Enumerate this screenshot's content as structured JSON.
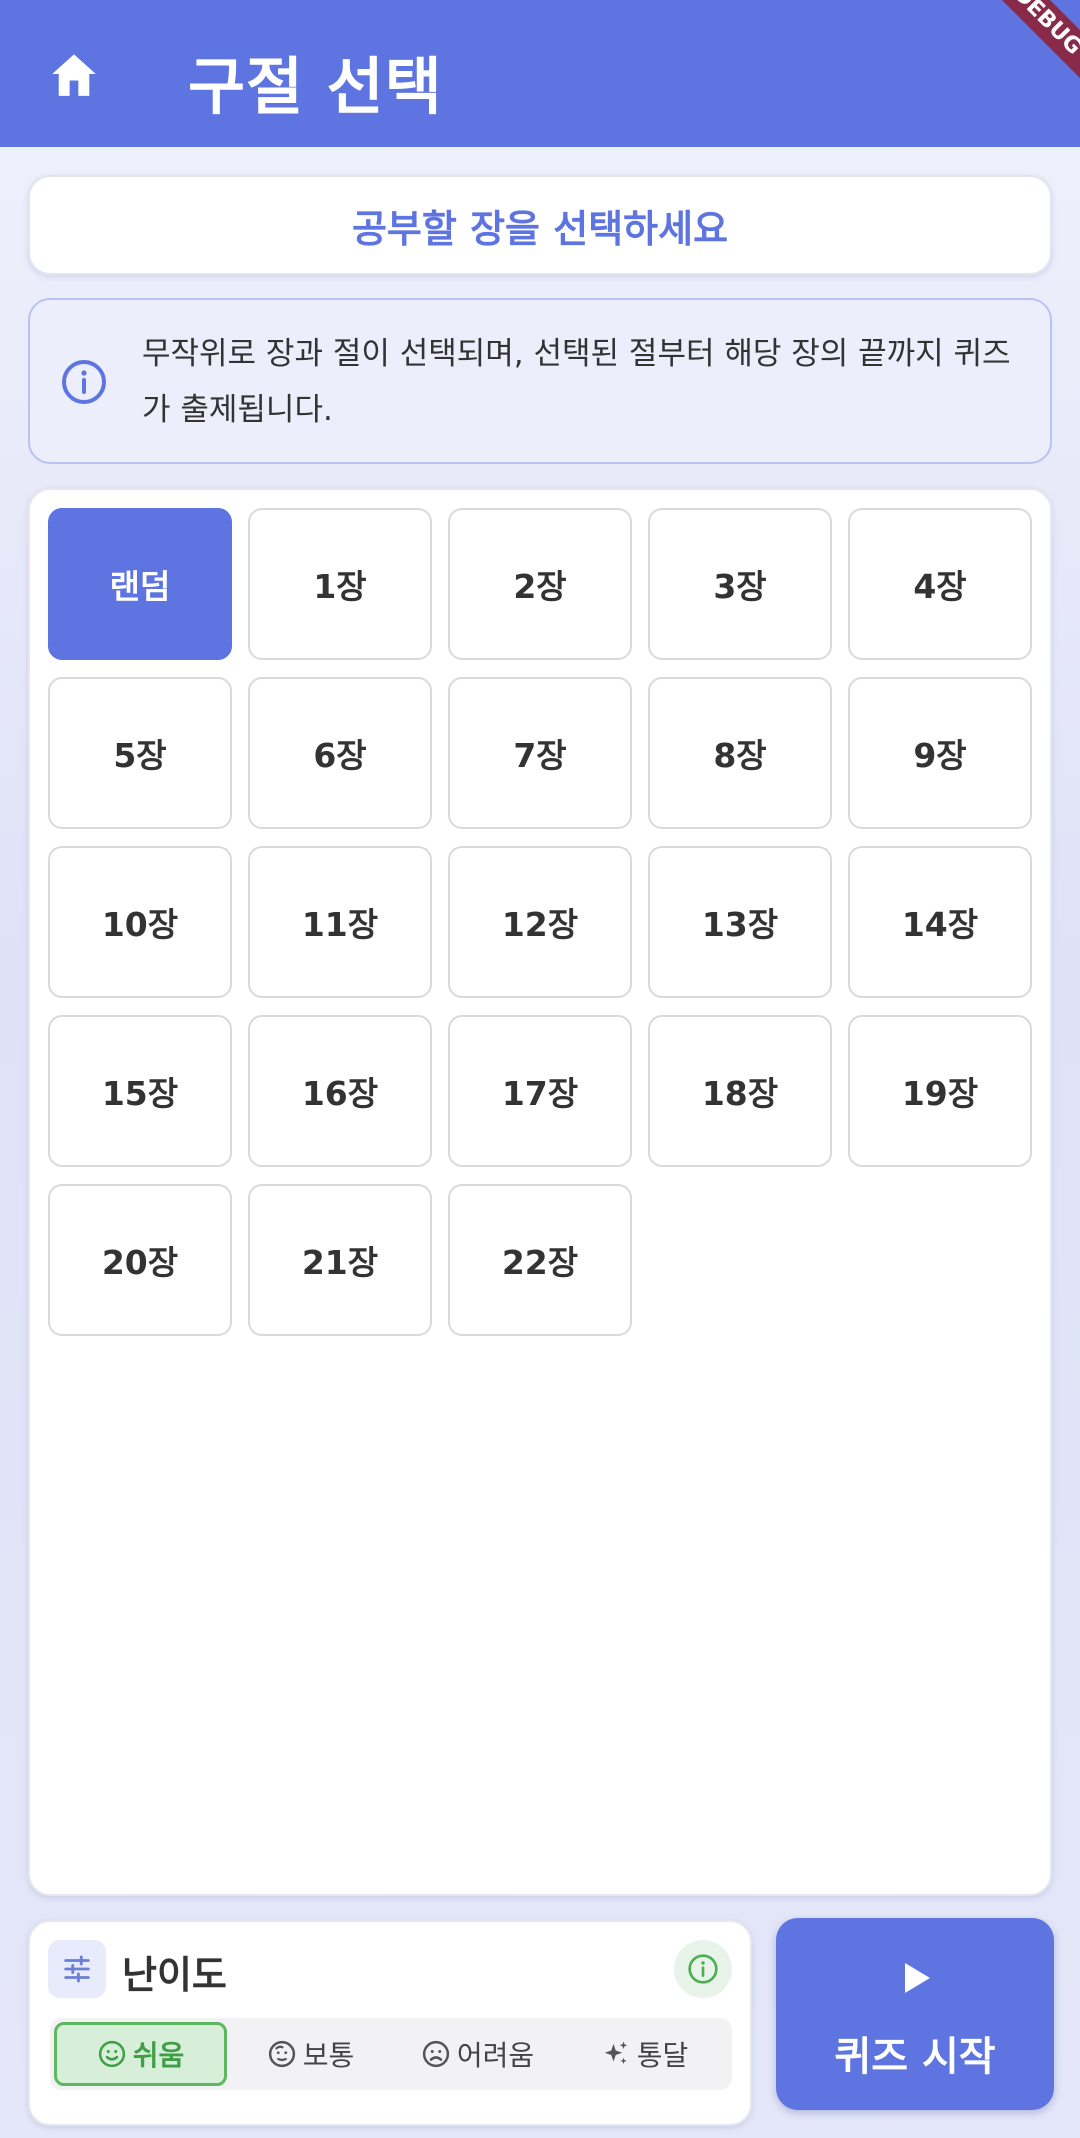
{
  "appbar": {
    "title": "구절 선택",
    "home_icon": "home-icon",
    "debug_label": "DEBUG",
    "color": "#5e74e0"
  },
  "prompt": {
    "text": "공부할 장을 선택하세요"
  },
  "info": {
    "icon": "info-icon",
    "text": "무작위로 장과 절이 선택되며, 선택된 절부터 해당 장의 끝까지 퀴즈가 출제됩니다."
  },
  "chapters": {
    "selected": "랜덤",
    "items": [
      "랜덤",
      "1장",
      "2장",
      "3장",
      "4장",
      "5장",
      "6장",
      "7장",
      "8장",
      "9장",
      "10장",
      "11장",
      "12장",
      "13장",
      "14장",
      "15장",
      "16장",
      "17장",
      "18장",
      "19장",
      "20장",
      "21장",
      "22장"
    ]
  },
  "difficulty": {
    "title": "난이도",
    "title_icon": "tune-icon",
    "info_icon": "info-icon",
    "options": [
      {
        "label": "쉬움",
        "icon": "smile-icon",
        "active": true
      },
      {
        "label": "보통",
        "icon": "neutral-face-icon",
        "active": false
      },
      {
        "label": "어려움",
        "icon": "sad-face-icon",
        "active": false
      },
      {
        "label": "통달",
        "icon": "sparkle-icon",
        "active": false
      }
    ],
    "active_color": "#5cb860"
  },
  "start": {
    "label": "퀴즈 시작",
    "icon": "play-icon"
  }
}
